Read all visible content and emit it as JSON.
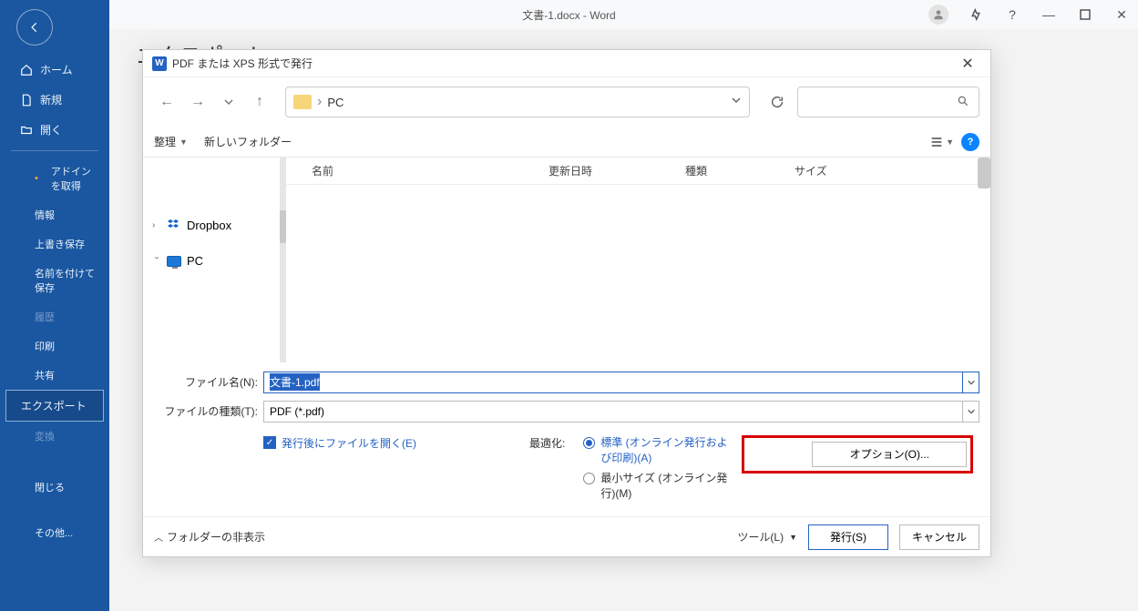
{
  "window": {
    "title": "文書-1.docx  -  Word"
  },
  "backstage": {
    "heading": "エクスポート",
    "nav": {
      "home": "ホーム",
      "new": "新規",
      "open": "開く",
      "addins": "アドインを取得",
      "info": "情報",
      "save": "上書き保存",
      "saveas": "名前を付けて保存",
      "history": "履歴",
      "print": "印刷",
      "share": "共有",
      "export": "エクスポート",
      "transform": "変換",
      "close": "閉じる",
      "other": "その他..."
    }
  },
  "dialog": {
    "title": "PDF または XPS 形式で発行",
    "breadcrumb": "PC",
    "toolbar": {
      "organize": "整理",
      "newfolder": "新しいフォルダー"
    },
    "columns": {
      "name": "名前",
      "date": "更新日時",
      "kind": "種類",
      "size": "サイズ"
    },
    "tree": {
      "dropbox": "Dropbox",
      "pc": "PC"
    },
    "form": {
      "filename_label": "ファイル名(N):",
      "filename_value": "文書-1.pdf",
      "filetype_label": "ファイルの種類(T):",
      "filetype_value": "PDF (*.pdf)",
      "openafter": "発行後にファイルを開く(E)",
      "optimize_label": "最適化:",
      "opt_standard": "標準 (オンライン発行および印刷)(A)",
      "opt_min": "最小サイズ (オンライン発行)(M)",
      "options_btn": "オプション(O)..."
    },
    "footer": {
      "folders": "フォルダーの非表示",
      "tools": "ツール(L)",
      "publish": "発行(S)",
      "cancel": "キャンセル"
    }
  }
}
